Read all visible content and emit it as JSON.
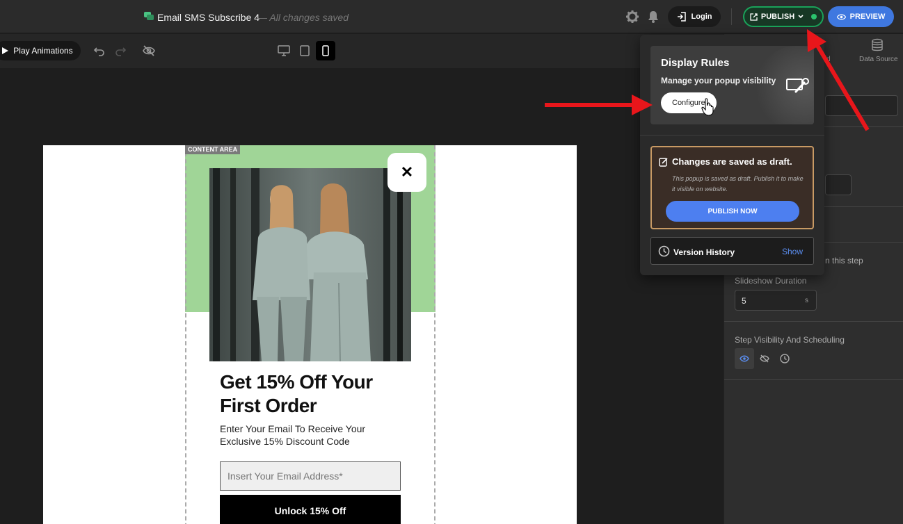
{
  "app": {
    "doc_title": "Email SMS Subscribe 4",
    "save_status": "— All changes saved"
  },
  "topbar": {
    "login_label": "Login",
    "publish_label": "PUBLISH",
    "preview_label": "PREVIEW",
    "icons": [
      "gear-icon",
      "bell-icon",
      "login-icon",
      "external-link-icon",
      "chevron-down-icon",
      "eye-icon"
    ]
  },
  "toolbar": {
    "play_label": "Play Animations",
    "icons": [
      "play-icon",
      "undo-icon",
      "redo-icon",
      "eye-off-icon",
      "desktop-icon",
      "tablet-icon",
      "mobile-icon"
    ],
    "active_device": "mobile"
  },
  "canvas": {
    "content_tag": "CONTENT AREA",
    "close_glyph": "✕",
    "headline": "Get 15% Off Your First Order",
    "subtext": "Enter Your Email To Receive Your Exclusive 15% Discount Code",
    "email_placeholder": "Insert Your Email Address*",
    "button_label": "Unlock 15% Off"
  },
  "dropdown": {
    "display_rules_title": "Display Rules",
    "display_rules_subtitle": "Manage your popup visibility",
    "configure_label": "Configure",
    "draft_title": "Changes are saved as draft.",
    "draft_text": "This popup is saved as draft. Publish it to make it visible on website.",
    "publish_now_label": "PUBLISH NOW",
    "version_label": "Version History",
    "version_action": "Show"
  },
  "right_panel": {
    "tab_data_source": "Data Source",
    "tab_partial": "d",
    "step_text_partial": "n this step",
    "slideshow_label": "Slideshow Duration",
    "slideshow_value": "5",
    "slideshow_unit": "s",
    "visibility_label": "Step Visibility And Scheduling"
  },
  "colors": {
    "publish_border": "#1aa35a",
    "preview_bg": "#3f78e0",
    "green_band": "#a0d597",
    "draft_border": "#c89a64",
    "link_blue": "#5b8ef0",
    "annotation_arrow": "#e8161b"
  }
}
